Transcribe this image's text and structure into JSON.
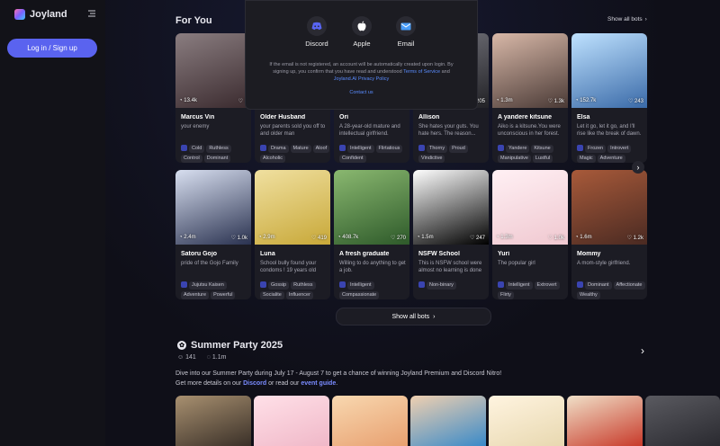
{
  "app": {
    "name": "Joyland"
  },
  "sidebar": {
    "login_label": "Log in / Sign up"
  },
  "for_you": {
    "title": "For You",
    "show_all_label": "Show all bots",
    "show_all_bottom_label": "Show all bots",
    "row1": [
      {
        "chats": "13.4k",
        "likes": "1",
        "name": "Marcus Vin",
        "desc": "your enemy",
        "tags": [
          "Cold",
          "Ruthless",
          "Control",
          "Dominant"
        ],
        "colors": [
          "#3a2a2e",
          "#8a7d80"
        ]
      },
      {
        "chats": "",
        "likes": "",
        "name": "Older Husband",
        "desc": "your parents sold you off to and older man",
        "tags": [
          "Drama",
          "Mature",
          "Aloof",
          "Alcoholic"
        ],
        "colors": [
          "#2a2a30",
          "#55504c"
        ]
      },
      {
        "chats": "",
        "likes": "",
        "name": "Ori",
        "desc": "A 28-year-old mature and intellectual girlfriend.",
        "tags": [
          "Intelligent",
          "Flirtatious",
          "Confident"
        ],
        "colors": [
          "#2a2430",
          "#6a5a60"
        ]
      },
      {
        "chats": "",
        "likes": "205",
        "name": "Allison",
        "desc": "She hates your guts. You hate hers. The reason...",
        "tags": [
          "Thorny",
          "Proud",
          "Vindictive"
        ],
        "colors": [
          "#222226",
          "#777780"
        ]
      },
      {
        "chats": "1.3m",
        "likes": "1.3k",
        "name": "A yandere kitsune",
        "desc": "Aiko is a kitsune.You were unconscious in her forest.",
        "tags": [
          "Yandere",
          "Kitsune",
          "Manipulative",
          "Lustful"
        ],
        "colors": [
          "#4a3a36",
          "#d8b8a8"
        ]
      },
      {
        "chats": "152.7k",
        "likes": "243",
        "name": "Elsa",
        "desc": "Let it go, let it go, and I'll rise like the break of dawn.",
        "tags": [
          "Frozen",
          "Introvert",
          "Magic",
          "Adventure"
        ],
        "colors": [
          "#3a6aa8",
          "#bfe2ff"
        ]
      }
    ],
    "row2": [
      {
        "chats": "2.4m",
        "likes": "1.0k",
        "name": "Satoru Gojo",
        "desc": "pride of the Gojo Family",
        "tags": [
          "Jujutsu Kaisen",
          "Adventure",
          "Powerful"
        ],
        "colors": [
          "#2a3250",
          "#d8dff0"
        ]
      },
      {
        "chats": "2.9m",
        "likes": "419",
        "name": "Luna",
        "desc": "School bully found your condoms ! 19 years old",
        "tags": [
          "Gossip",
          "Ruthless",
          "Socialite",
          "Influencer"
        ],
        "colors": [
          "#c8a838",
          "#f0e0a0"
        ]
      },
      {
        "chats": "408.7k",
        "likes": "270",
        "name": "A fresh graduate",
        "desc": "Willing to do anything to get a job.",
        "tags": [
          "Intelligent",
          "Compassionate"
        ],
        "colors": [
          "#2e5a2a",
          "#8ab870"
        ]
      },
      {
        "chats": "1.5m",
        "likes": "247",
        "name": "NSFW School",
        "desc": "This is NSFW school were almost no learning is done",
        "tags": [
          "Non-binary"
        ],
        "colors": [
          "#000000",
          "#ffffff"
        ]
      },
      {
        "chats": "1.3m",
        "likes": "1.0k",
        "name": "Yuri",
        "desc": "The popular girl",
        "tags": [
          "Intelligent",
          "Extrovert",
          "Flirty"
        ],
        "colors": [
          "#f0c8d0",
          "#fff0f4"
        ]
      },
      {
        "chats": "1.6m",
        "likes": "1.2k",
        "name": "Mommy",
        "desc": "A mom-style girlfriend.",
        "tags": [
          "Dominant",
          "Affectionate",
          "Wealthy"
        ],
        "colors": [
          "#4a2a22",
          "#a85a3a"
        ]
      }
    ]
  },
  "event": {
    "title": "Summer Party 2025",
    "participants": "141",
    "views": "1.1m",
    "desc_line1": "Dive into our Summer Party during July 17 - August 7 to get a chance of winning Joyland Premium and Discord Nitro!",
    "desc_prefix": "Get more details on our",
    "discord_link": "Discord",
    "desc_mid": "or read our",
    "guide_link": "event guide",
    "desc_end": ".",
    "images": [
      [
        "#3a3028",
        "#a89070"
      ],
      [
        "#f0b8c8",
        "#ffe0e8"
      ],
      [
        "#e8a070",
        "#f8d8b0"
      ],
      [
        "#3a8ac8",
        "#f0d0b0"
      ],
      [
        "#e8d8b0",
        "#fff4e0"
      ],
      [
        "#c83a2a",
        "#f0e0c8"
      ],
      [
        "#2a2a30",
        "#5a5a60"
      ]
    ]
  },
  "modal": {
    "providers": [
      "Discord",
      "Apple",
      "Email"
    ],
    "note_text": "If the email is not registered, an account will be automatically created upon login. By signing up, you confirm that you have read and understood",
    "terms_link": "Terms of Service",
    "and_text": "and",
    "privacy_link": "Joyland.AI Privacy Policy",
    "contact_link": "Contact us"
  },
  "icons": {
    "chats": "chat-bubble-icon",
    "likes": "heart-icon",
    "next": "chevron-right-icon"
  },
  "colors": {
    "accent": "#5a63ef",
    "link": "#5a8cff"
  }
}
